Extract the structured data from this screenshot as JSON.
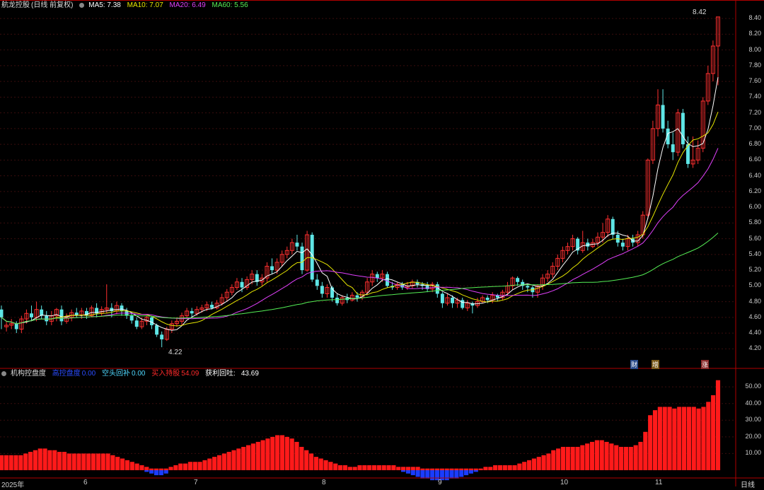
{
  "main_legend": {
    "name": "航龙控股",
    "mode": "(日线 前复权)",
    "ma5": "MA5: 7.38",
    "ma10": "MA10: 7.07",
    "ma20": "MA20: 6.49",
    "ma60": "MA60: 5.56",
    "colors": {
      "ma5": "#ffffff",
      "ma10": "#e6e600",
      "ma20": "#e040fb",
      "ma60": "#55ee55"
    }
  },
  "sub_legend": {
    "name": "机构控盘度",
    "item1_label": "高控盘度",
    "item1_value": "0.00",
    "item2_label": "空头回补",
    "item2_value": "0.00",
    "item3_label": "买入持股",
    "item3_value": "54.09",
    "item4_label": "获利回吐",
    "item4_value": "43.69"
  },
  "annotations": {
    "high_price": "8.42",
    "low_price": "4.22",
    "tag1": "财",
    "tag2": "增",
    "tag3": "涨"
  },
  "x_axis_labels": [
    "2025年",
    "6",
    "7",
    "8",
    "9",
    "10",
    "11"
  ],
  "period_tab": "日线",
  "chart_data": [
    {
      "type": "candlestick",
      "title": "航龙控股 (日线 前复权)",
      "ylim": [
        4.05,
        8.5
      ],
      "y_ticks": [
        "8.40",
        "8.20",
        "8.00",
        "7.80",
        "7.60",
        "7.40",
        "7.20",
        "7.00",
        "6.80",
        "6.60",
        "6.40",
        "6.20",
        "6.00",
        "5.80",
        "5.60",
        "5.40",
        "5.20",
        "5.00",
        "4.80",
        "4.60",
        "4.40",
        "4.20"
      ],
      "grid": true,
      "ohlc": [
        [
          4.7,
          4.6,
          4.75,
          4.45
        ],
        [
          4.48,
          4.5,
          4.55,
          4.42
        ],
        [
          4.5,
          4.52,
          4.58,
          4.45
        ],
        [
          4.52,
          4.45,
          4.55,
          4.4
        ],
        [
          4.45,
          4.58,
          4.62,
          4.4
        ],
        [
          4.58,
          4.65,
          4.7,
          4.52
        ],
        [
          4.65,
          4.6,
          4.75,
          4.55
        ],
        [
          4.6,
          4.7,
          4.8,
          4.55
        ],
        [
          4.7,
          4.62,
          4.75,
          4.58
        ],
        [
          4.62,
          4.55,
          4.68,
          4.5
        ],
        [
          4.55,
          4.62,
          4.68,
          4.5
        ],
        [
          4.62,
          4.7,
          4.72,
          4.55
        ],
        [
          4.7,
          4.55,
          4.75,
          4.5
        ],
        [
          4.55,
          4.6,
          4.65,
          4.52
        ],
        [
          4.6,
          4.66,
          4.7,
          4.55
        ],
        [
          4.66,
          4.63,
          4.72,
          4.6
        ],
        [
          4.63,
          4.68,
          4.72,
          4.58
        ],
        [
          4.68,
          4.62,
          4.72,
          4.58
        ],
        [
          4.62,
          4.72,
          4.75,
          4.6
        ],
        [
          4.72,
          4.65,
          4.78,
          4.6
        ],
        [
          4.65,
          4.7,
          4.74,
          4.62
        ],
        [
          4.7,
          4.72,
          5.02,
          4.65
        ],
        [
          4.72,
          4.68,
          4.78,
          4.6
        ],
        [
          4.68,
          4.75,
          4.8,
          4.64
        ],
        [
          4.75,
          4.68,
          4.78,
          4.62
        ],
        [
          4.68,
          4.62,
          4.72,
          4.58
        ],
        [
          4.62,
          4.56,
          4.66,
          4.52
        ],
        [
          4.56,
          4.48,
          4.6,
          4.45
        ],
        [
          4.48,
          4.55,
          4.6,
          4.45
        ],
        [
          4.55,
          4.6,
          4.62,
          4.5
        ],
        [
          4.6,
          4.5,
          4.62,
          4.45
        ],
        [
          4.5,
          4.38,
          4.52,
          4.35
        ],
        [
          4.38,
          4.32,
          4.42,
          4.22
        ],
        [
          4.32,
          4.45,
          4.48,
          4.3
        ],
        [
          4.45,
          4.52,
          4.56,
          4.4
        ],
        [
          4.52,
          4.55,
          4.6,
          4.48
        ],
        [
          4.55,
          4.62,
          4.66,
          4.5
        ],
        [
          4.62,
          4.68,
          4.72,
          4.58
        ],
        [
          4.68,
          4.65,
          4.72,
          4.6
        ],
        [
          4.65,
          4.7,
          4.74,
          4.62
        ],
        [
          4.7,
          4.72,
          4.76,
          4.66
        ],
        [
          4.72,
          4.76,
          4.8,
          4.68
        ],
        [
          4.76,
          4.72,
          4.8,
          4.7
        ],
        [
          4.72,
          4.78,
          4.82,
          4.7
        ],
        [
          4.78,
          4.85,
          4.9,
          4.75
        ],
        [
          4.85,
          4.92,
          4.96,
          4.8
        ],
        [
          4.92,
          4.98,
          5.02,
          4.88
        ],
        [
          4.98,
          5.05,
          5.1,
          4.95
        ],
        [
          5.05,
          4.98,
          5.1,
          4.92
        ],
        [
          4.98,
          5.08,
          5.12,
          4.95
        ],
        [
          5.08,
          5.15,
          5.2,
          5.02
        ],
        [
          5.15,
          5.05,
          5.2,
          5.0
        ],
        [
          5.05,
          5.1,
          5.15,
          5.0
        ],
        [
          5.1,
          5.25,
          5.3,
          5.05
        ],
        [
          5.25,
          5.2,
          5.35,
          5.15
        ],
        [
          5.2,
          5.3,
          5.35,
          5.15
        ],
        [
          5.3,
          5.4,
          5.45,
          5.25
        ],
        [
          5.4,
          5.45,
          5.5,
          5.35
        ],
        [
          5.45,
          5.55,
          5.6,
          5.4
        ],
        [
          5.55,
          5.5,
          5.65,
          5.45
        ],
        [
          5.5,
          5.2,
          5.55,
          5.15
        ],
        [
          5.2,
          5.65,
          5.7,
          5.18
        ],
        [
          5.65,
          5.08,
          5.68,
          5.05
        ],
        [
          5.08,
          5.0,
          5.15,
          4.95
        ],
        [
          5.0,
          4.9,
          5.05,
          4.85
        ],
        [
          4.9,
          4.98,
          5.02,
          4.85
        ],
        [
          4.98,
          4.85,
          5.0,
          4.8
        ],
        [
          4.85,
          4.78,
          4.9,
          4.75
        ],
        [
          4.78,
          4.85,
          4.88,
          4.75
        ],
        [
          4.85,
          4.82,
          4.9,
          4.78
        ],
        [
          4.82,
          4.88,
          4.92,
          4.8
        ],
        [
          4.88,
          4.85,
          4.92,
          4.8
        ],
        [
          4.85,
          4.92,
          4.95,
          4.82
        ],
        [
          4.92,
          5.05,
          5.1,
          4.88
        ],
        [
          5.05,
          5.15,
          5.2,
          5.0
        ],
        [
          5.15,
          5.1,
          5.18,
          5.05
        ],
        [
          5.1,
          5.15,
          5.2,
          5.05
        ],
        [
          5.15,
          5.0,
          5.18,
          4.98
        ],
        [
          5.0,
          4.98,
          5.05,
          4.95
        ],
        [
          4.98,
          5.02,
          5.05,
          4.95
        ],
        [
          5.02,
          4.98,
          5.05,
          4.95
        ],
        [
          4.98,
          5.0,
          5.05,
          4.95
        ],
        [
          5.0,
          5.05,
          5.08,
          4.97
        ],
        [
          5.05,
          5.02,
          5.08,
          4.98
        ],
        [
          5.02,
          5.0,
          5.05,
          4.95
        ],
        [
          5.0,
          4.96,
          5.05,
          4.92
        ],
        [
          4.96,
          5.02,
          5.05,
          4.92
        ],
        [
          5.02,
          4.9,
          5.05,
          4.85
        ],
        [
          4.9,
          4.78,
          4.92,
          4.72
        ],
        [
          4.78,
          4.85,
          4.9,
          4.75
        ],
        [
          4.85,
          4.78,
          4.88,
          4.72
        ],
        [
          4.78,
          4.82,
          4.85,
          4.72
        ],
        [
          4.82,
          4.72,
          4.85,
          4.7
        ],
        [
          4.72,
          4.78,
          4.82,
          4.68
        ],
        [
          4.78,
          4.75,
          4.8,
          4.65
        ],
        [
          4.75,
          4.8,
          4.85,
          4.72
        ],
        [
          4.8,
          4.85,
          4.88,
          4.78
        ],
        [
          4.85,
          4.82,
          4.88,
          4.78
        ],
        [
          4.82,
          4.88,
          4.92,
          4.78
        ],
        [
          4.88,
          4.85,
          4.9,
          4.8
        ],
        [
          4.85,
          4.92,
          4.95,
          4.82
        ],
        [
          4.92,
          5.0,
          5.05,
          4.88
        ],
        [
          5.0,
          5.1,
          5.12,
          4.95
        ],
        [
          5.1,
          5.05,
          5.12,
          5.0
        ],
        [
          5.05,
          5.0,
          5.08,
          4.95
        ],
        [
          5.0,
          4.98,
          5.02,
          4.92
        ],
        [
          4.98,
          4.92,
          5.0,
          4.85
        ],
        [
          4.92,
          5.0,
          5.02,
          4.85
        ],
        [
          5.0,
          5.1,
          5.15,
          4.95
        ],
        [
          5.1,
          5.15,
          5.2,
          5.05
        ],
        [
          5.15,
          5.25,
          5.3,
          5.1
        ],
        [
          5.25,
          5.35,
          5.4,
          5.2
        ],
        [
          5.35,
          5.45,
          5.5,
          5.3
        ],
        [
          5.45,
          5.5,
          5.55,
          5.4
        ],
        [
          5.5,
          5.6,
          5.65,
          5.45
        ],
        [
          5.6,
          5.45,
          5.62,
          5.4
        ],
        [
          5.45,
          5.55,
          5.7,
          5.42
        ],
        [
          5.55,
          5.5,
          5.6,
          5.45
        ],
        [
          5.5,
          5.55,
          5.6,
          5.48
        ],
        [
          5.55,
          5.62,
          5.68,
          5.5
        ],
        [
          5.62,
          5.68,
          5.8,
          5.55
        ],
        [
          5.68,
          5.85,
          5.9,
          5.62
        ],
        [
          5.85,
          5.65,
          5.88,
          5.6
        ],
        [
          5.65,
          5.55,
          5.7,
          5.5
        ],
        [
          5.55,
          5.5,
          5.6,
          5.45
        ],
        [
          5.5,
          5.6,
          5.65,
          5.45
        ],
        [
          5.6,
          5.55,
          5.65,
          5.5
        ],
        [
          5.55,
          5.65,
          5.7,
          5.5
        ],
        [
          5.65,
          5.9,
          5.95,
          5.6
        ],
        [
          5.9,
          6.6,
          6.62,
          5.85
        ],
        [
          6.6,
          7.0,
          7.1,
          6.55
        ],
        [
          7.0,
          7.3,
          7.5,
          6.9
        ],
        [
          7.3,
          7.0,
          7.5,
          6.95
        ],
        [
          7.0,
          6.8,
          7.1,
          6.75
        ],
        [
          6.8,
          6.7,
          6.95,
          6.6
        ],
        [
          6.7,
          7.2,
          7.25,
          6.65
        ],
        [
          7.2,
          6.8,
          7.25,
          6.75
        ],
        [
          6.8,
          6.55,
          6.9,
          6.5
        ],
        [
          6.55,
          6.6,
          6.9,
          6.5
        ],
        [
          6.6,
          6.75,
          6.85,
          6.55
        ],
        [
          6.75,
          7.35,
          7.4,
          6.7
        ],
        [
          7.35,
          7.7,
          7.8,
          7.3
        ],
        [
          7.7,
          8.05,
          8.12,
          7.6
        ],
        [
          8.05,
          8.42,
          8.42,
          7.55
        ]
      ],
      "ma_lines": [
        "MA5",
        "MA10",
        "MA20",
        "MA60"
      ]
    },
    {
      "type": "bar",
      "title": "机构控盘度",
      "ylim": [
        0,
        56
      ],
      "y_ticks": [
        "50.00",
        "40.00",
        "30.00",
        "20.00",
        "10.00"
      ],
      "series": [
        {
          "name": "买入持股",
          "color": "#ff1a1a",
          "values": [
            9,
            9,
            9,
            9,
            9,
            10,
            11,
            12,
            13,
            13,
            12,
            12,
            11,
            11,
            10,
            10,
            10,
            10,
            10,
            10,
            10,
            10,
            10,
            9,
            8,
            7,
            6,
            5,
            4,
            3,
            2,
            1,
            1,
            1,
            1,
            2,
            3,
            4,
            4,
            5,
            5,
            5,
            6,
            7,
            8,
            9,
            10,
            11,
            12,
            13,
            14,
            15,
            16,
            17,
            18,
            19,
            20,
            21,
            21,
            20,
            19,
            17,
            14,
            12,
            10,
            8,
            7,
            6,
            5,
            4,
            3,
            3,
            2,
            2,
            3,
            3,
            3,
            3,
            3,
            3,
            3,
            3,
            2,
            2,
            2,
            2,
            2,
            1,
            1,
            1,
            1,
            1,
            1,
            1,
            1,
            1,
            1,
            1,
            1,
            1,
            2,
            2,
            3,
            3,
            3,
            3,
            3,
            4,
            5,
            6,
            7,
            8,
            9,
            10,
            12,
            13,
            14,
            14,
            14,
            14,
            15,
            16,
            17,
            18,
            18,
            17,
            16,
            15,
            14,
            14,
            14,
            15,
            17,
            23,
            33,
            36,
            38,
            38,
            38,
            37,
            38,
            38,
            38,
            38,
            37,
            38,
            41,
            45,
            54
          ]
        },
        {
          "name": "获利回吐",
          "color": "#1a3cff",
          "values": [
            0,
            0,
            0,
            0,
            0,
            0,
            0,
            0,
            0,
            0,
            0,
            0,
            0,
            0,
            0,
            0,
            0,
            0,
            0,
            0,
            0,
            0,
            0,
            0,
            0,
            0,
            0,
            0,
            0,
            0,
            1,
            2,
            3,
            3,
            2,
            0,
            0,
            0,
            0,
            0,
            0,
            0,
            0,
            0,
            0,
            0,
            0,
            0,
            0,
            0,
            0,
            0,
            0,
            0,
            0,
            0,
            0,
            0,
            0,
            0,
            0,
            0,
            0,
            0,
            0,
            0,
            0,
            0,
            0,
            0,
            0,
            0,
            0,
            0,
            0,
            0,
            0,
            0,
            0,
            0,
            0,
            0,
            0,
            1,
            2,
            3,
            4,
            5,
            5,
            6,
            6,
            6,
            6,
            5,
            5,
            4,
            3,
            2,
            1,
            0,
            0,
            0,
            0,
            0,
            0,
            0,
            0,
            0,
            0,
            0,
            0,
            0,
            0,
            0,
            0,
            0,
            0,
            0,
            0,
            0,
            0,
            0,
            0,
            0,
            0,
            0,
            0,
            0,
            0,
            0,
            0,
            0,
            0,
            0,
            0,
            0,
            0,
            0,
            0,
            0,
            0,
            0,
            0,
            0,
            0,
            0,
            0,
            0,
            0
          ]
        }
      ]
    }
  ]
}
